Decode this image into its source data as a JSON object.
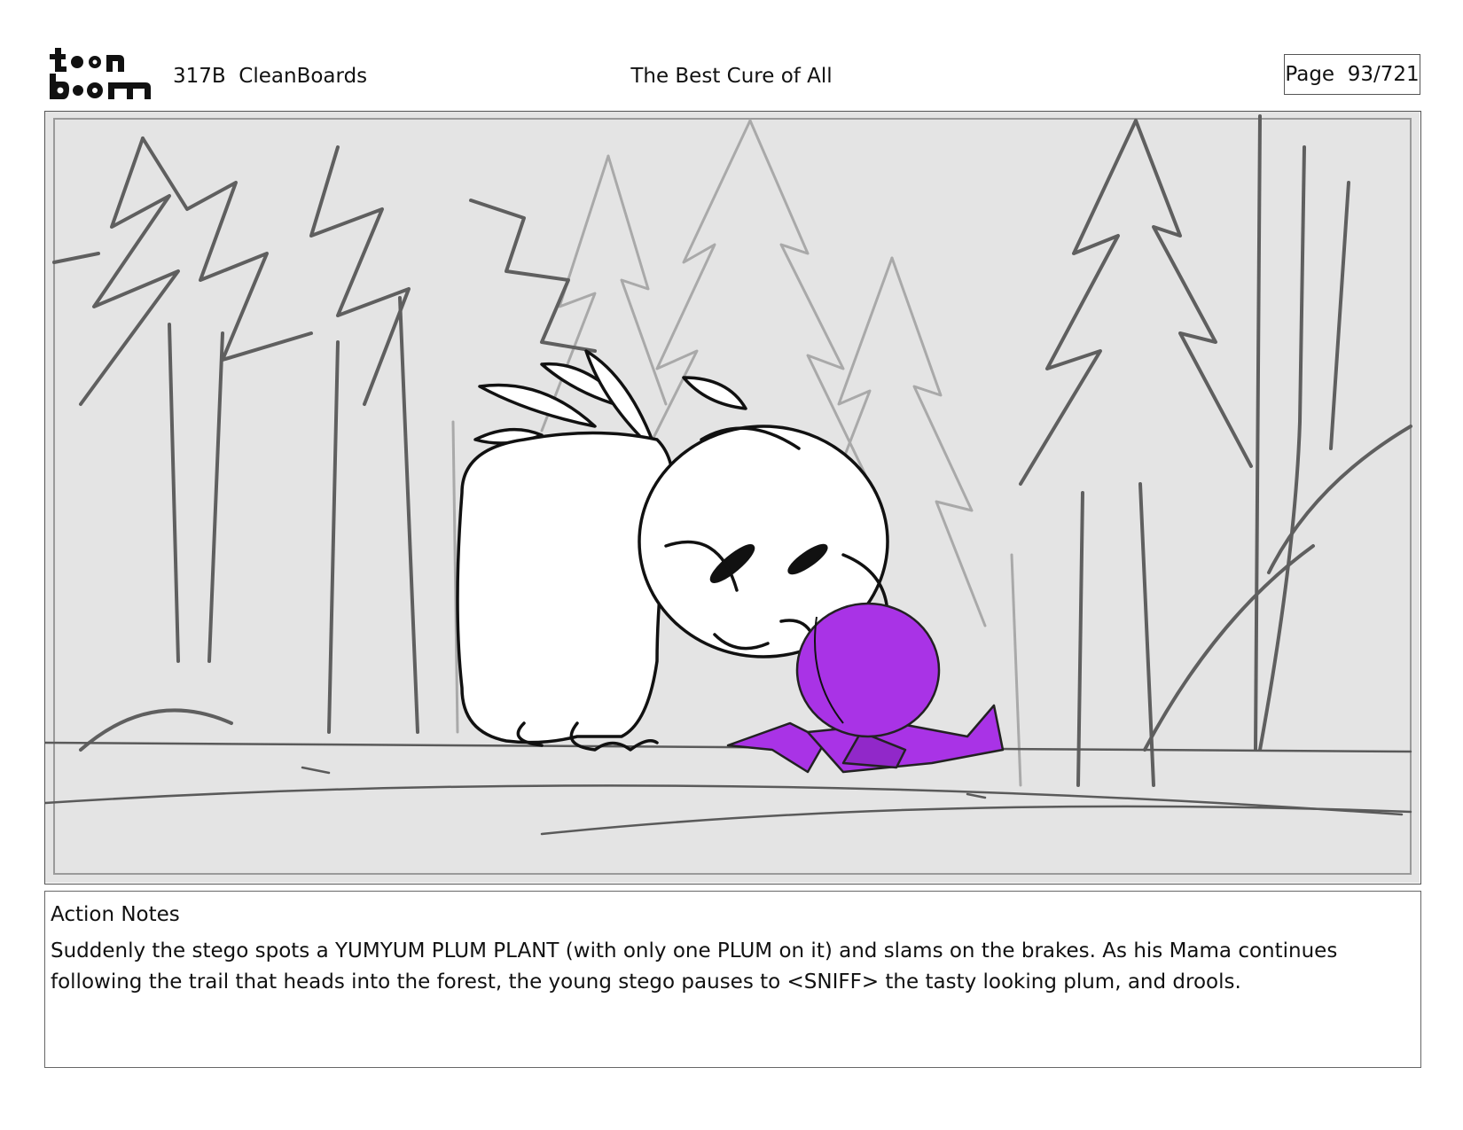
{
  "logo": {
    "line1": "toon",
    "line2": "boom",
    "brand": "Toon Boom"
  },
  "header": {
    "scene": "317B  CleanBoards",
    "title": "The Best Cure of All",
    "page": "Page  93/721"
  },
  "panel": {
    "icons": [
      "stego-character",
      "plum-plant",
      "forest-trees"
    ],
    "colors": {
      "background": "#e3e3e3",
      "plum": "#a933e6",
      "lines": "#5e5e5e"
    }
  },
  "notes": {
    "heading": "Action Notes",
    "text": "Suddenly the stego spots a YUMYUM PLUM PLANT (with only one PLUM on it) and slams on the brakes. As his Mama continues following the trail that heads into the forest, the young stego pauses to <SNIFF> the tasty looking plum, and drools."
  }
}
